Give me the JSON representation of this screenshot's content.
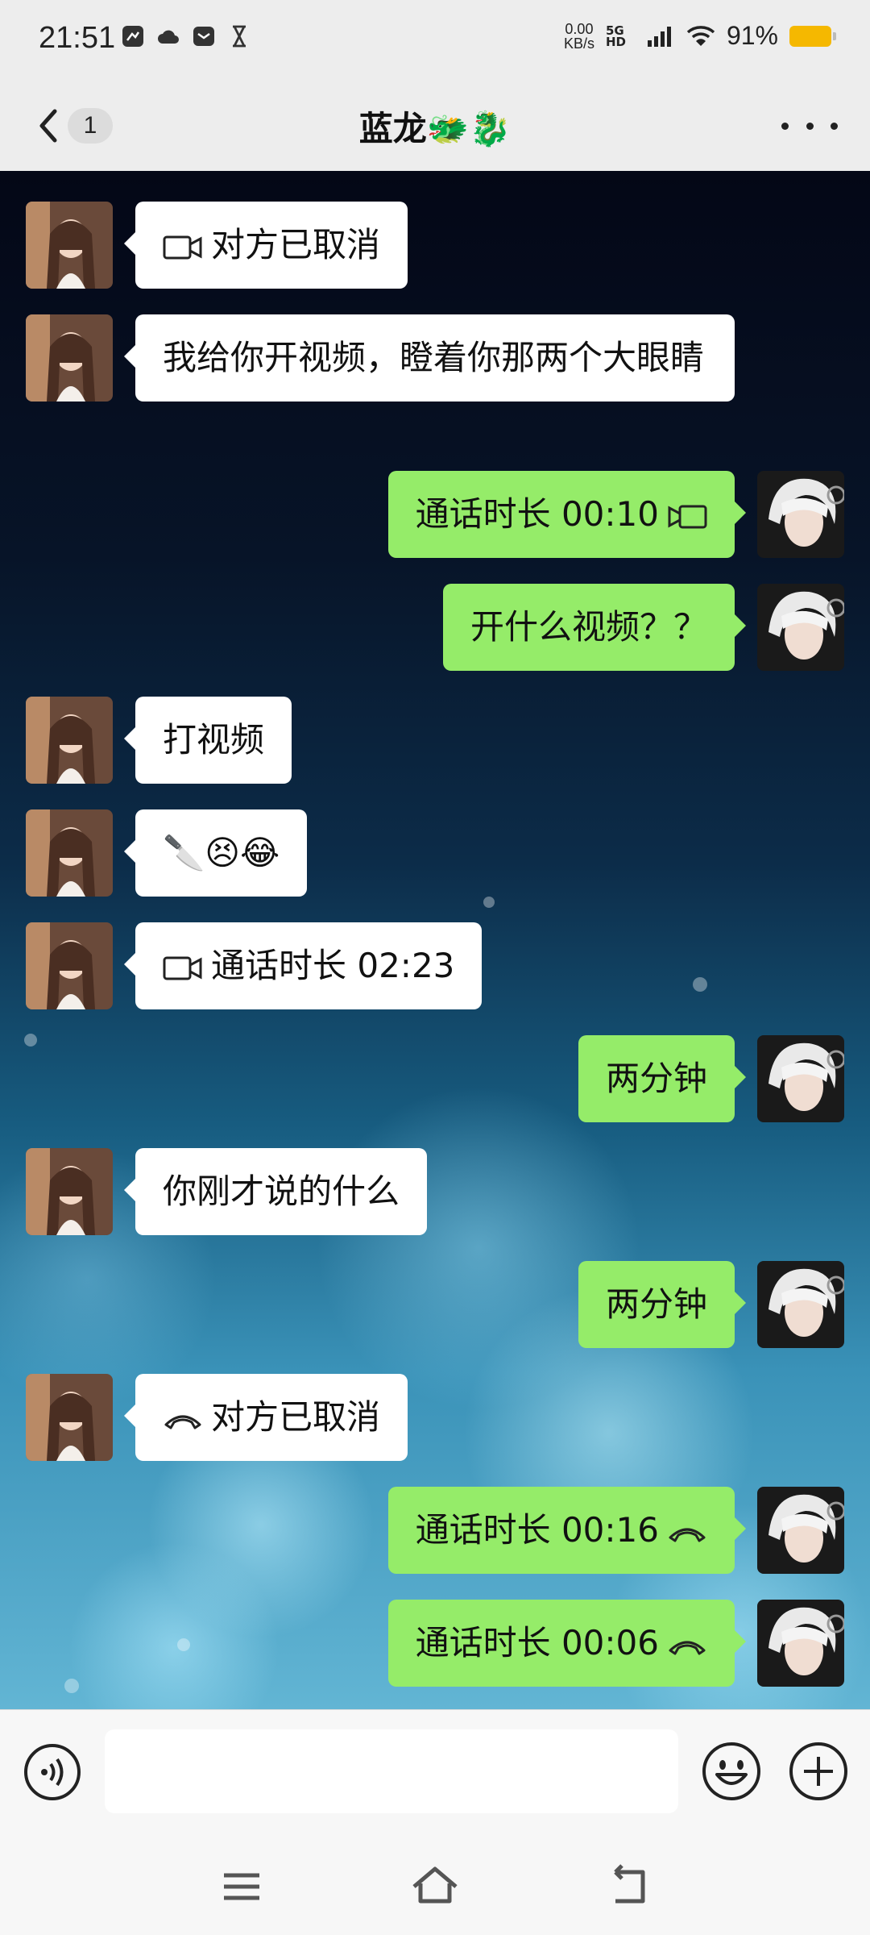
{
  "status": {
    "time": "21:51",
    "net_speed": "0.00",
    "net_unit": "KB/s",
    "network": "5G HD",
    "battery": "91%"
  },
  "header": {
    "unread_count": "1",
    "title": "蓝龙🐲🐉"
  },
  "messages": [
    {
      "side": "left",
      "text": "对方已取消",
      "icon": "video-camera-icon"
    },
    {
      "side": "left",
      "text": "我给你开视频，瞪着你那两个大眼睛"
    },
    {
      "side": "right",
      "text": "通话时长 00:10",
      "icon": "video-camera-icon"
    },
    {
      "side": "right",
      "text": "开什么视频？？"
    },
    {
      "side": "left",
      "text": "打视频"
    },
    {
      "side": "left",
      "text": "🔪😣😂"
    },
    {
      "side": "left",
      "text": "通话时长 02:23",
      "icon": "video-camera-icon"
    },
    {
      "side": "right",
      "text": "两分钟"
    },
    {
      "side": "left",
      "text": "你刚才说的什么"
    },
    {
      "side": "right",
      "text": "两分钟"
    },
    {
      "side": "left",
      "text": "对方已取消",
      "icon": "phone-hangup-icon"
    },
    {
      "side": "right",
      "text": "通话时长 00:16",
      "icon": "phone-hangup-icon"
    },
    {
      "side": "right",
      "text": "通话时长 00:06",
      "icon": "phone-hangup-icon"
    }
  ],
  "input": {
    "value": "",
    "placeholder": ""
  },
  "colors": {
    "my_bubble": "#95ec69",
    "their_bubble": "#ffffff",
    "battery": "#f5b800"
  }
}
